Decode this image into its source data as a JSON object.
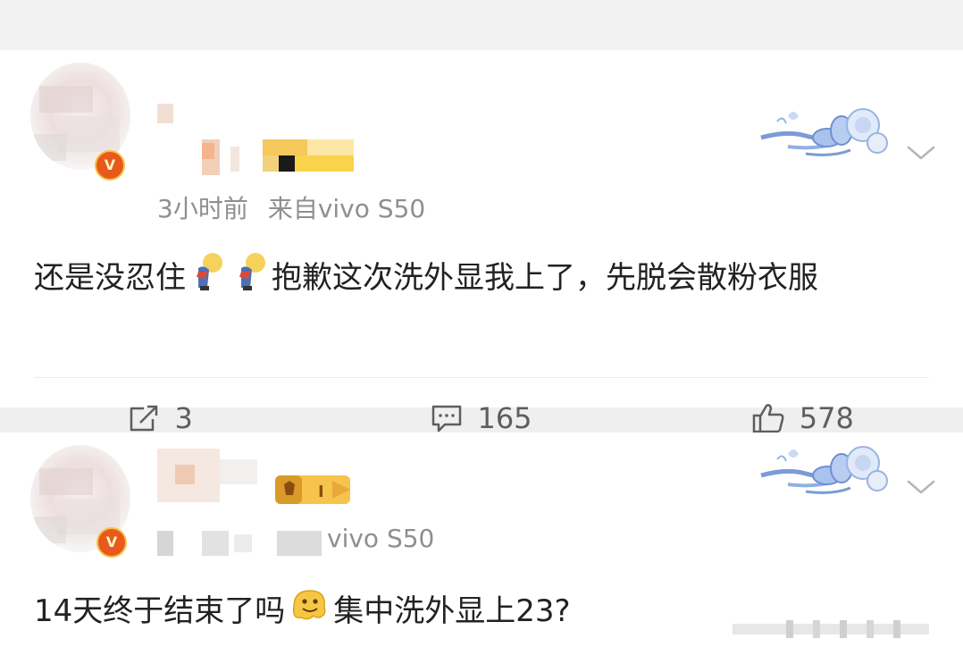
{
  "posts": [
    {
      "meta": {
        "time": "3小时前",
        "source": "来自vivo S50"
      },
      "content": {
        "part1": "还是没忍住",
        "part2": "抱歉这次洗外显我上了，先脱会散粉衣服"
      },
      "actions": {
        "repost_count": "3",
        "comment_count": "165",
        "like_count": "578"
      },
      "icons": {
        "vip_badge": "v-badge-icon",
        "decoration": "bow-flower-decoration",
        "expand": "chevron-down-icon",
        "repost": "repost-icon",
        "comment": "comment-icon",
        "like": "thumbs-up-icon",
        "inline_emoji": "bowing-person-emoji"
      }
    },
    {
      "meta": {
        "source": "vivo S50"
      },
      "content": {
        "part1": "14天终于结束了吗",
        "part2": "集中洗外显上23?"
      },
      "icons": {
        "vip_badge": "v-badge-icon",
        "level_badge": "level-badge-icon",
        "decoration": "bow-flower-decoration",
        "expand": "chevron-down-icon",
        "inline_emoji": "melting-face-emoji"
      }
    }
  ],
  "colors": {
    "background": "#f2f2f2",
    "card": "#ffffff",
    "text": "#222222",
    "meta": "#8f8f8f",
    "action": "#5e5e5e",
    "accent_decoration": "#7a9bd6"
  }
}
